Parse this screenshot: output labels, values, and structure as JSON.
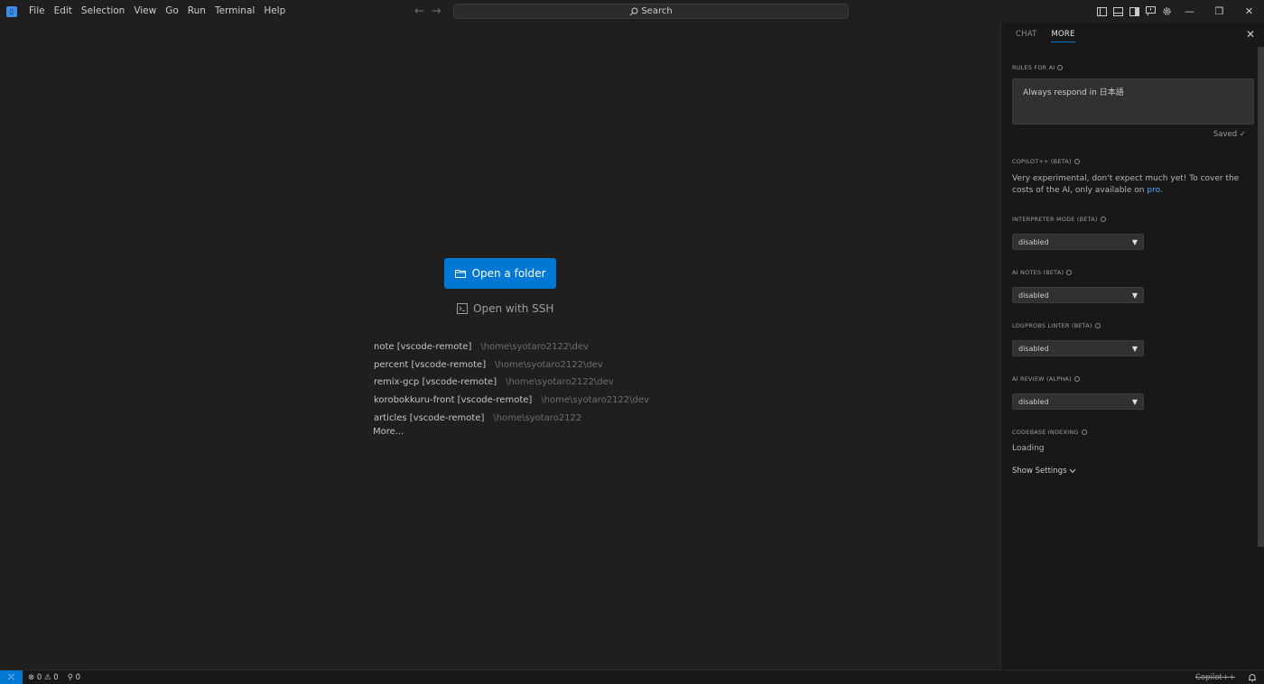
{
  "titlebar": {
    "menus": [
      "File",
      "Edit",
      "Selection",
      "View",
      "Go",
      "Run",
      "Terminal",
      "Help"
    ],
    "search_label": "Search"
  },
  "editor": {
    "open_folder_label": "Open a folder",
    "open_ssh_label": "Open with SSH",
    "recent": [
      {
        "name": "note [vscode-remote]",
        "path": "\\home\\syotaro2122\\dev"
      },
      {
        "name": "percent [vscode-remote]",
        "path": "\\home\\syotaro2122\\dev"
      },
      {
        "name": "remix-gcp [vscode-remote]",
        "path": "\\home\\syotaro2122\\dev"
      },
      {
        "name": "korobokkuru-front [vscode-remote]",
        "path": "\\home\\syotaro2122\\dev"
      },
      {
        "name": "articles [vscode-remote]",
        "path": "\\home\\syotaro2122"
      }
    ],
    "more_label": "More..."
  },
  "panel": {
    "tabs": [
      "CHAT",
      "MORE"
    ],
    "active_tab": "MORE",
    "rules_label": "RULES FOR AI",
    "rules_value": "Always respond in 日本語",
    "saved_label": "Saved ✓",
    "copilot_label": "COPILOT++ (BETA)",
    "copilot_desc": "Very experimental, don't expect much yet! To cover the costs of the AI, only available on",
    "copilot_link": "pro",
    "interpreter_label": "INTERPRETER MODE (BETA)",
    "interpreter_value": "disabled",
    "ai_notes_label": "AI NOTES (BETA)",
    "ai_notes_value": "disabled",
    "logprobs_label": "LOGPROBS LINTER (BETA)",
    "logprobs_value": "disabled",
    "ai_review_label": "AI REVIEW (ALPHA)",
    "ai_review_value": "disabled",
    "codebase_label": "CODEBASE INDEXING",
    "codebase_status": "Loading",
    "show_settings_label": "Show Settings"
  },
  "statusbar": {
    "errors": "0",
    "warnings": "0",
    "ports": "0",
    "copilot": "Copilot++"
  },
  "colors": {
    "accent": "#0078d4",
    "background": "#1f1f1f",
    "panel": "#181818",
    "link": "#4daafc"
  }
}
